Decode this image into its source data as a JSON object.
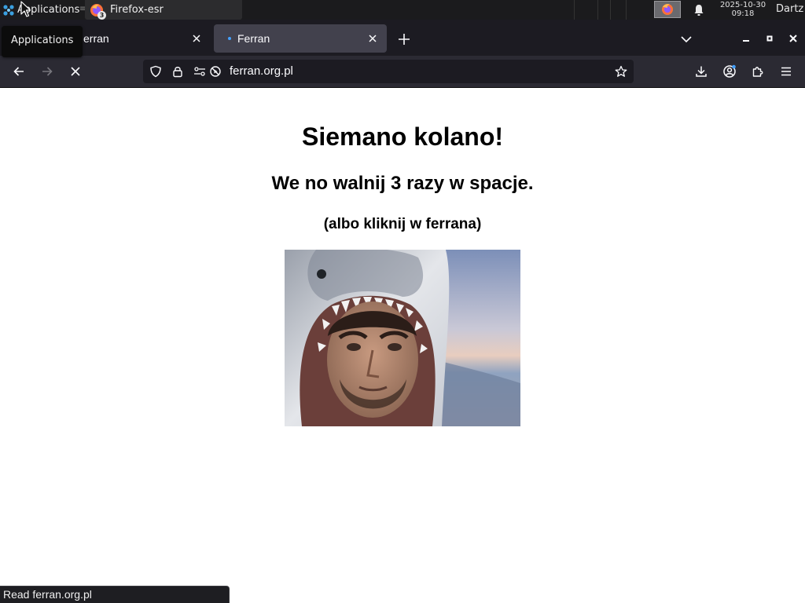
{
  "panel": {
    "applications_label": "Applications",
    "separator": "≡",
    "task_label": "Firefox-esr",
    "task_badge": "3",
    "clock_date": "2025-10-30",
    "clock_time": "09:18",
    "user": "Dartz",
    "tooltip": "Applications"
  },
  "tabs": [
    {
      "title": "Ferran",
      "active": false,
      "visible_text": "erran"
    },
    {
      "title": "Ferran",
      "active": true
    }
  ],
  "navbar": {
    "url": "ferran.org.pl"
  },
  "page": {
    "heading": "Siemano kolano!",
    "subheading": "We no walnij 3 razy w spacje.",
    "hint": "(albo kliknij w ferrana)",
    "image_icon": "shark-hoodie-portrait"
  },
  "status": {
    "text": "Read ferran.org.pl"
  },
  "colors": {
    "panel_bg": "#1b1b1d",
    "tabstrip_bg": "#1c1b22",
    "active_tab_bg": "#42414d",
    "navbar_bg": "#2b2a33",
    "urlbar_bg": "#1c1b22",
    "tab_loading_dot": "#45a1ff"
  }
}
